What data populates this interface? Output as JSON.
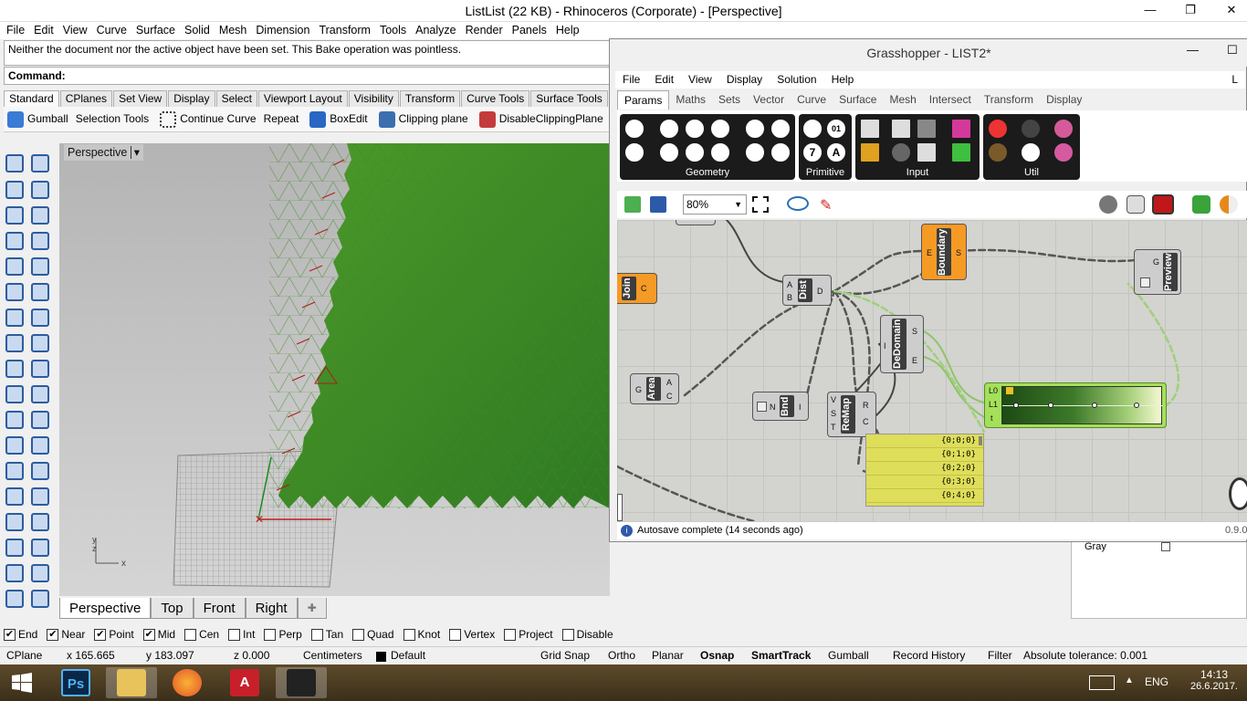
{
  "rhino": {
    "title": "ListList (22 KB) - Rhinoceros (Corporate) - [Perspective]",
    "window_controls": {
      "minimize": "—",
      "restore": "❐",
      "close": "✕"
    },
    "menu": [
      "File",
      "Edit",
      "View",
      "Curve",
      "Surface",
      "Solid",
      "Mesh",
      "Dimension",
      "Transform",
      "Tools",
      "Analyze",
      "Render",
      "Panels",
      "Help"
    ],
    "history_line": "Neither the document nor the active object have been set. This Bake operation was pointless.",
    "command_label": "Command:",
    "toolbar_tabs": [
      "Standard",
      "CPlanes",
      "Set View",
      "Display",
      "Select",
      "Viewport Layout",
      "Visibility",
      "Transform",
      "Curve Tools",
      "Surface Tools"
    ],
    "tools": [
      "Gumball",
      "Selection Tools",
      "Continue Curve",
      "Repeat",
      "BoxEdit",
      "Clipping plane",
      "DisableClippingPlane"
    ],
    "viewport_label": "Perspective",
    "axis": {
      "y": "y",
      "z": "z",
      "x": "x"
    },
    "view_tabs": [
      "Perspective",
      "Top",
      "Front",
      "Right"
    ],
    "view_tab_add": "✚",
    "osnaps": [
      {
        "label": "End",
        "checked": true
      },
      {
        "label": "Near",
        "checked": true
      },
      {
        "label": "Point",
        "checked": true
      },
      {
        "label": "Mid",
        "checked": true
      },
      {
        "label": "Cen",
        "checked": false
      },
      {
        "label": "Int",
        "checked": false
      },
      {
        "label": "Perp",
        "checked": false
      },
      {
        "label": "Tan",
        "checked": false
      },
      {
        "label": "Quad",
        "checked": false
      },
      {
        "label": "Knot",
        "checked": false
      },
      {
        "label": "Vertex",
        "checked": false
      },
      {
        "label": "Project",
        "checked": false
      },
      {
        "label": "Disable",
        "checked": false
      }
    ],
    "status": {
      "cplane": "CPlane",
      "x": "x 165.665",
      "y": "y 183.097",
      "z": "z 0.000",
      "units": "Centimeters",
      "layer": "Default",
      "grid_snap": "Grid Snap",
      "ortho": "Ortho",
      "planar": "Planar",
      "osnap": "Osnap",
      "smarttrack": "SmartTrack",
      "gumball": "Gumball",
      "record_history": "Record History",
      "filter": "Filter",
      "tolerance": "Absolute tolerance: 0.001"
    },
    "right_panel": {
      "row_label": "Gray"
    }
  },
  "grasshopper": {
    "title": "Grasshopper - LIST2*",
    "menu": [
      "File",
      "Edit",
      "View",
      "Display",
      "Solution",
      "Help"
    ],
    "menu_trailing": "L",
    "tabs": [
      "Params",
      "Maths",
      "Sets",
      "Vector",
      "Curve",
      "Surface",
      "Mesh",
      "Intersect",
      "Transform",
      "Display"
    ],
    "active_tab": "Params",
    "ribbon_groups": [
      "Geometry",
      "Primitive",
      "Input",
      "Util"
    ],
    "primitive_glyphs": [
      "01",
      "7",
      "A"
    ],
    "zoom": "80%",
    "nodes": {
      "join": {
        "name": "Join",
        "out": "C"
      },
      "boundary": {
        "name": "Boundary",
        "in": "E",
        "out": "S"
      },
      "preview": {
        "name": "Preview",
        "in": "G"
      },
      "dist": {
        "name": "Dist",
        "in_a": "A",
        "in_b": "B",
        "out": "D"
      },
      "dedomain": {
        "name": "DeDomain",
        "in": "I",
        "out_s": "S",
        "out_e": "E"
      },
      "area": {
        "name": "Area",
        "in": "G",
        "out_a": "A",
        "out_c": "C"
      },
      "bnd": {
        "name": "Bnd",
        "in": "N",
        "out": "I"
      },
      "remap": {
        "name": "ReMap",
        "in_v": "V",
        "in_s": "S",
        "in_t": "T",
        "out_r": "R",
        "out_c": "C"
      },
      "gradient": {
        "in_l0": "L0",
        "in_l1": "L1",
        "in_t": "t"
      }
    },
    "panel_rows": [
      "{0;0;0}",
      "{0;1;0}",
      "{0;2;0}",
      "{0;3;0}",
      "{0;4;0}"
    ],
    "status_text": "Autosave complete (14 seconds ago)",
    "version": "0.9.0"
  },
  "taskbar": {
    "apps": [
      "windows-start",
      "photoshop",
      "file-explorer",
      "firefox",
      "autocad",
      "rhinoceros"
    ],
    "ps_label": "Ps",
    "acad_label": "A",
    "language": "ENG",
    "time": "14:13",
    "date": "26.6.2017."
  },
  "colors": {
    "accent_green": "#4f9f2e",
    "gh_orange": "#f59a25",
    "gh_panel_yellow": "#dede5a",
    "gh_canvas": "#d3d3cf"
  }
}
